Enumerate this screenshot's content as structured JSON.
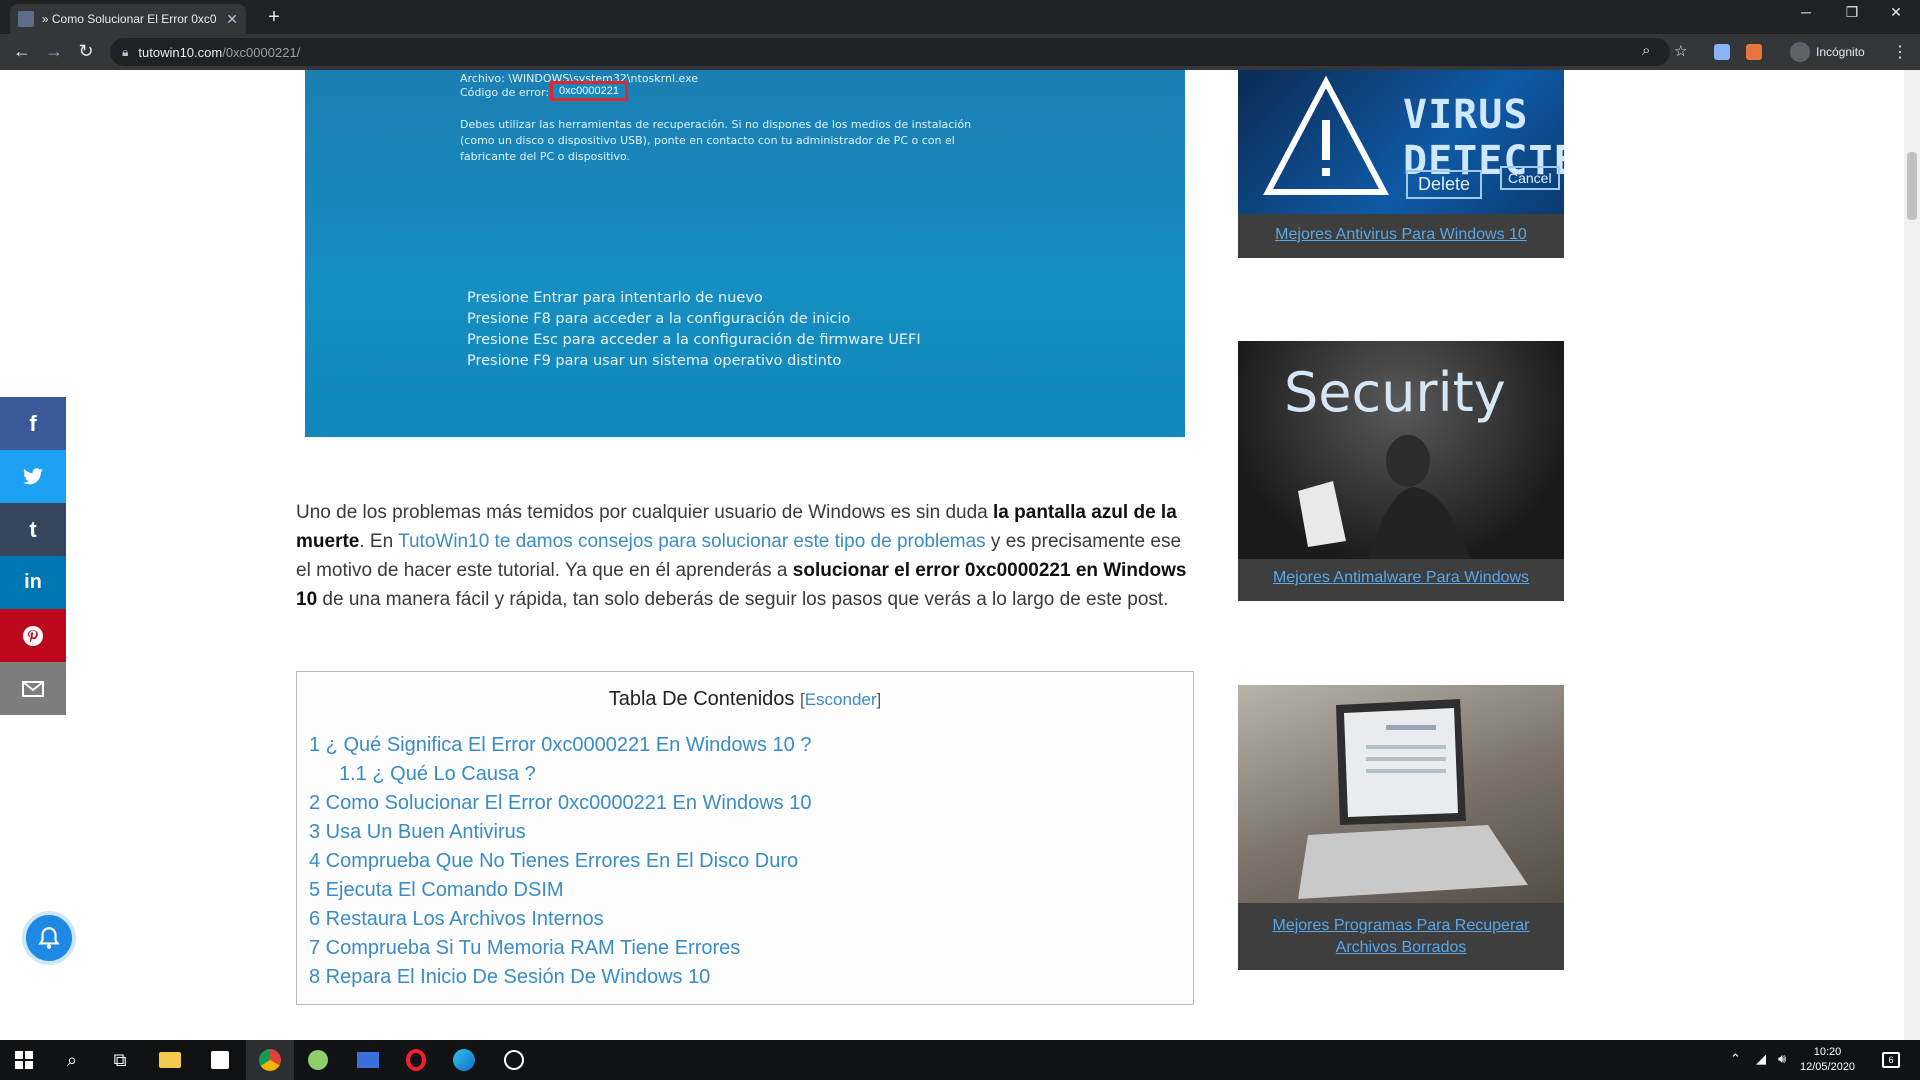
{
  "browser": {
    "tab_title": "» Como Solucionar El Error 0xc0",
    "url_host": "tutowin10.com",
    "url_path": "/0xc0000221/",
    "profile_label": "Incógnito"
  },
  "hero": {
    "file_line": "Archivo: \\WINDOWS\\system32\\ntoskrnl.exe",
    "code_label": "Código de error:",
    "code_value": "0xc0000221",
    "info_line1": "Debes utilizar las herramientas de recuperación. Si no dispones de los medios de instalación",
    "info_line2": "(como un disco o dispositivo USB), ponte en contacto con tu administrador de PC o con el",
    "info_line3": "fabricante del PC o dispositivo.",
    "press1": "Presione Entrar para intentarlo de nuevo",
    "press2": "Presione F8 para acceder a la configuración de inicio",
    "press3": "Presione Esc para acceder a la configuración de firmware UEFI",
    "press4": "Presione F9 para usar un sistema operativo distinto"
  },
  "article": {
    "p1": "Uno de los problemas más temidos por cualquier usuario de Windows es sin duda ",
    "p1_bold": "la pantalla azul de la muerte",
    "p2": ". En ",
    "p2_link": "TutoWin10 te damos consejos para solucionar este tipo de problemas",
    "p3": " y es precisamente ese el motivo de hacer este tutorial. Ya que en él aprenderás a ",
    "p3_bold": "solucionar el error 0xc0000221 en Windows 10",
    "p4": " de una manera fácil y rápida, tan solo deberás de seguir los pasos que verás a lo largo de este post."
  },
  "toc": {
    "title": "Tabla De Contenidos",
    "hide_label": "Esconder",
    "items": [
      "1 ¿ Qué Significa El Error 0xc0000221 En Windows 10 ?",
      "1.1 ¿ Qué Lo Causa ?",
      "2 Como Solucionar El Error 0xc0000221 En Windows 10",
      "3 Usa Un Buen Antivirus",
      "4 Comprueba Que No Tienes Errores En El Disco Duro",
      "5 Ejecuta El Comando DSIM",
      "6 Restaura Los Archivos Internos",
      "7 Comprueba Si Tu Memoria RAM Tiene Errores",
      "8 Repara El Inicio De Sesión De Windows 10"
    ]
  },
  "sidebar": {
    "cards": [
      {
        "caption": "Mejores Antivirus Para Windows 10",
        "img_text": "VIRUS DETECTED",
        "img_btn1": "Delete",
        "img_btn2": "Cancel"
      },
      {
        "caption": "Mejores Antimalware Para Windows",
        "img_text": "Security"
      },
      {
        "caption_line1": "Mejores Programas Para Recuperar",
        "caption_line2": "Archivos Borrados"
      }
    ]
  },
  "social": {
    "facebook": "f",
    "twitter": "twitter-icon",
    "tumblr": "t",
    "linkedin": "in",
    "pinterest": "pinterest-icon",
    "email": "email-icon",
    "colors": {
      "facebook": "#3b5998",
      "twitter": "#1da1f2",
      "tumblr": "#35465c",
      "linkedin": "#0077b5",
      "pinterest": "#bd081c",
      "email": "#7d7d7d"
    }
  },
  "taskbar": {
    "time": "10:20",
    "date": "12/05/2020",
    "notif_count": "6"
  }
}
